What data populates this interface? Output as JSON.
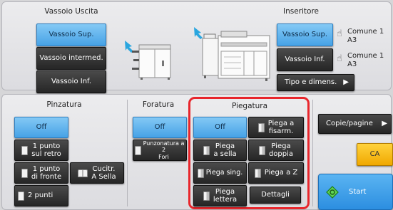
{
  "output_tray": {
    "title": "Vassoio Uscita",
    "options": [
      "Vassoio Sup.",
      "Vassoio intermed.",
      "Vassoio Inf."
    ]
  },
  "inserter": {
    "title": "Inseritore",
    "upper_label": "Vassoio Sup.",
    "lower_label": "Vassoio Inf.",
    "upper_paper": [
      "Comune 1",
      "A3"
    ],
    "lower_paper": [
      "Comune 1",
      "A3"
    ],
    "type_size_label": "Tipo e dimens."
  },
  "stapling": {
    "title": "Pinzatura",
    "off": "Off",
    "back_1": [
      "1 punto",
      "sul retro"
    ],
    "front_1": [
      "1 punto",
      "di fronte"
    ],
    "two_points": "2 punti",
    "saddle": [
      "Cucitr.",
      "A Sella"
    ]
  },
  "punching": {
    "title": "Foratura",
    "off": "Off",
    "two_holes": [
      "Punzonatura a 2",
      "Fori"
    ]
  },
  "folding": {
    "title": "Piegatura",
    "off": "Off",
    "accordion": [
      "Piega a",
      "fisarm."
    ],
    "saddle_fold": [
      "Piega",
      "a sella"
    ],
    "double_fold": [
      "Piega",
      "doppia"
    ],
    "single_fold": "Piega sing.",
    "z_fold": "Piega a Z",
    "letter_fold": [
      "Piega",
      "lettera"
    ],
    "details": "Dettagli"
  },
  "side": {
    "copies_pages": "Copie/pagine",
    "ca": "CA",
    "start": "Start"
  },
  "colors": {
    "selected": "#58acea",
    "dark_button": "#333333",
    "highlight": "#e8262c",
    "start_green": "#54c84a"
  }
}
